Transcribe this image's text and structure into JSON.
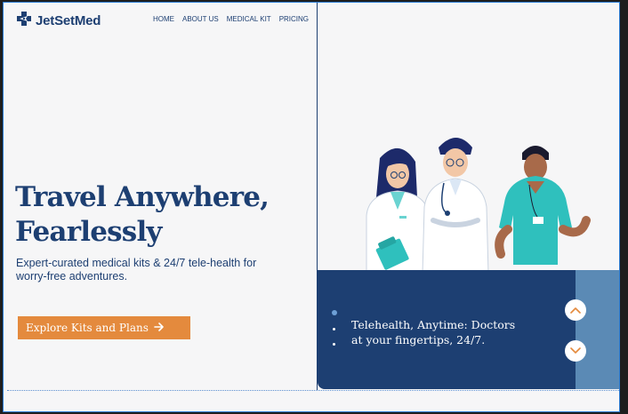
{
  "brand": {
    "name": "JetSetMed",
    "logo_icon": "medical-cross-plane-icon"
  },
  "nav": {
    "items": [
      {
        "label": "HOME"
      },
      {
        "label": "ABOUT US"
      },
      {
        "label": "MEDICAL KIT"
      },
      {
        "label": "PRICING"
      }
    ]
  },
  "hero": {
    "title_line1": "Travel Anywhere,",
    "title_line2": "Fearlessly",
    "subtitle": "Expert-curated medical kits & 24/7 tele-health for worry-free adventures.",
    "cta_label": "Explore Kits and Plans",
    "cta_icon": "arrow-right-icon"
  },
  "carousel": {
    "slide_text": "Telehealth, Anytime: Doctors at your fingertips, 24/7.",
    "active_index": 0,
    "slide_count": 3,
    "up_icon": "chevron-up-icon",
    "down_icon": "chevron-down-icon"
  },
  "colors": {
    "primary": "#1d3f72",
    "accent": "#e48a3d",
    "background": "#f6f6f7",
    "panel_side": "#5b8ab5"
  }
}
